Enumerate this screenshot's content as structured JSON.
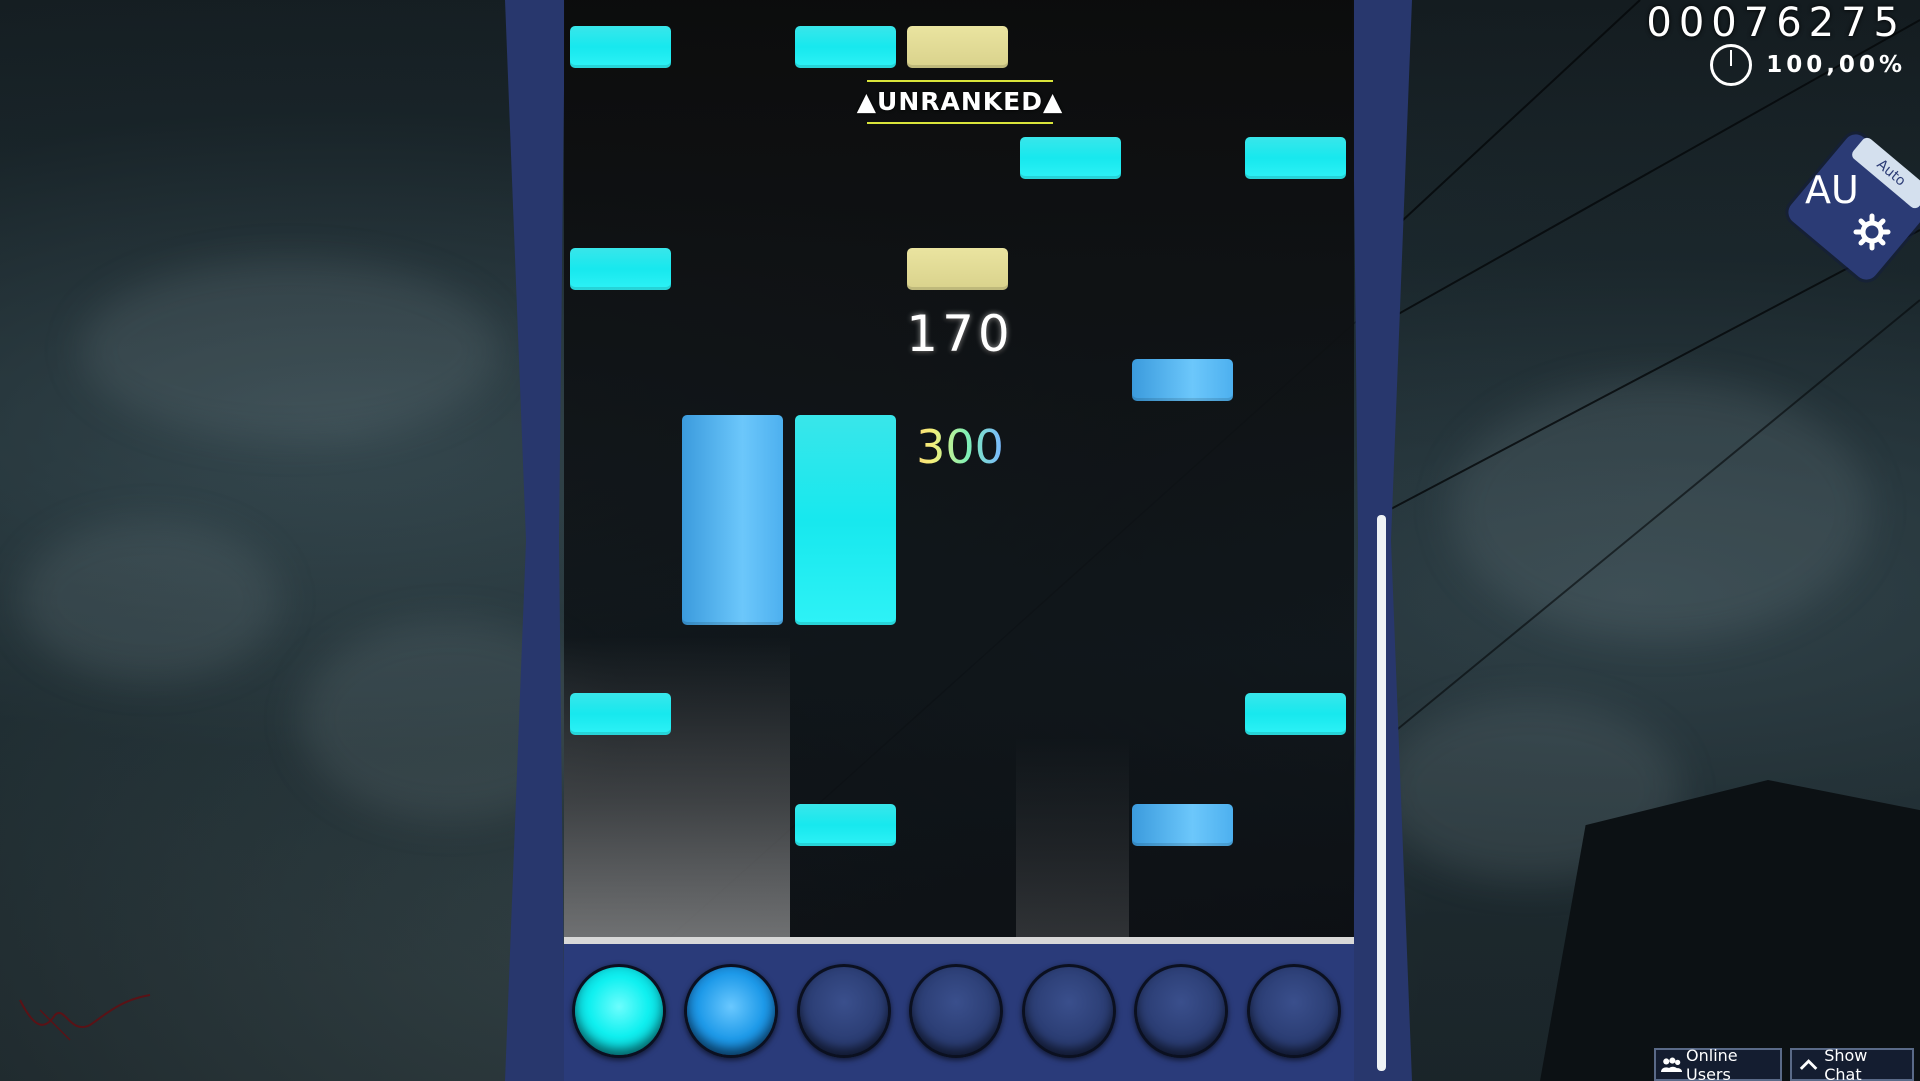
{
  "hud": {
    "score": "00076275",
    "accuracy": "100,00%",
    "combo": "170",
    "judgement": "300",
    "status_banner": "▲UNRANKED▲"
  },
  "mod_badge": {
    "label": "AU",
    "ribbon": "Auto"
  },
  "bottom_bar": {
    "online_users": "Online Users",
    "show_chat": "Show Chat"
  },
  "playfield": {
    "key_count": 7,
    "keys": [
      {
        "lane": 1,
        "state": "pressed",
        "color": "#10f0f0"
      },
      {
        "lane": 2,
        "state": "pressed",
        "color": "#1e9ae9"
      },
      {
        "lane": 3,
        "state": "idle",
        "color": "#2a3c72"
      },
      {
        "lane": 4,
        "state": "idle",
        "color": "#2a3c72"
      },
      {
        "lane": 5,
        "state": "idle",
        "color": "#2a3c72"
      },
      {
        "lane": 6,
        "state": "idle",
        "color": "#2a3c72"
      },
      {
        "lane": 7,
        "state": "idle",
        "color": "#2a3c72"
      }
    ],
    "note_colors": {
      "cyan": "#17e8ee",
      "blue": "#4db0ef",
      "gold": "#d9d28c"
    }
  },
  "colors": {
    "frame": "#28376d",
    "key_area": "#2a3b7a",
    "judge_line": "#d8d8d8",
    "banner_underline": "#d9e43a"
  },
  "icons": {
    "accuracy": "pie-clock-icon",
    "mod": "gear-icon",
    "online_users": "users-icon",
    "show_chat": "chevron-up-icon"
  }
}
